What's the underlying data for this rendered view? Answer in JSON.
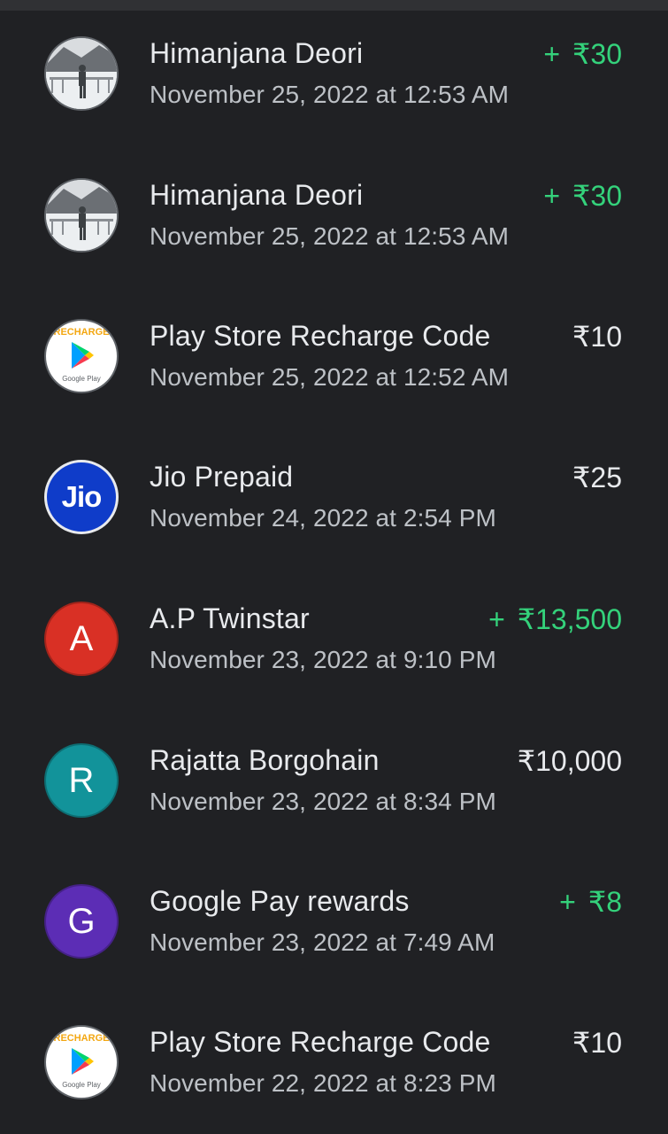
{
  "transactions": [
    {
      "name": "Himanjana Deori",
      "datetime": "November 25, 2022 at 12:53 AM",
      "sign": "+",
      "amount": "₹30",
      "type": "credit",
      "avatar": "photo"
    },
    {
      "name": "Himanjana Deori",
      "datetime": "November 25, 2022 at 12:53 AM",
      "sign": "+",
      "amount": "₹30",
      "type": "credit",
      "avatar": "photo"
    },
    {
      "name": "Play Store Recharge Code",
      "datetime": "November 25, 2022 at 12:52 AM",
      "sign": "",
      "amount": "₹10",
      "type": "debit",
      "avatar": "google-play",
      "avatar_title": "RECHARGE",
      "avatar_caption": "Google Play"
    },
    {
      "name": "Jio Prepaid",
      "datetime": "November 24, 2022 at 2:54 PM",
      "sign": "",
      "amount": "₹25",
      "type": "debit",
      "avatar": "jio",
      "avatar_text": "Jio"
    },
    {
      "name": "A.P Twinstar",
      "datetime": "November 23, 2022 at 9:10 PM",
      "sign": "+",
      "amount": "₹13,500",
      "type": "credit",
      "avatar": "letter",
      "avatar_letter": "A",
      "avatar_color": "#d93025"
    },
    {
      "name": "Rajatta Borgohain",
      "datetime": "November 23, 2022 at 8:34 PM",
      "sign": "",
      "amount": "₹10,000",
      "type": "debit",
      "avatar": "letter",
      "avatar_letter": "R",
      "avatar_color": "#12939a"
    },
    {
      "name": "Google Pay rewards",
      "datetime": "November 23, 2022 at 7:49 AM",
      "sign": "+",
      "amount": "₹8",
      "type": "credit",
      "avatar": "letter",
      "avatar_letter": "G",
      "avatar_color": "#5c2db5"
    },
    {
      "name": "Play Store Recharge Code",
      "datetime": "November 22, 2022 at 8:23 PM",
      "sign": "",
      "amount": "₹10",
      "type": "debit",
      "avatar": "google-play",
      "avatar_title": "RECHARGE",
      "avatar_caption": "Google Play"
    }
  ],
  "colors": {
    "background": "#202124",
    "credit": "#34d27b",
    "text_primary": "#e8eaed",
    "text_secondary": "#bdc1c6"
  }
}
